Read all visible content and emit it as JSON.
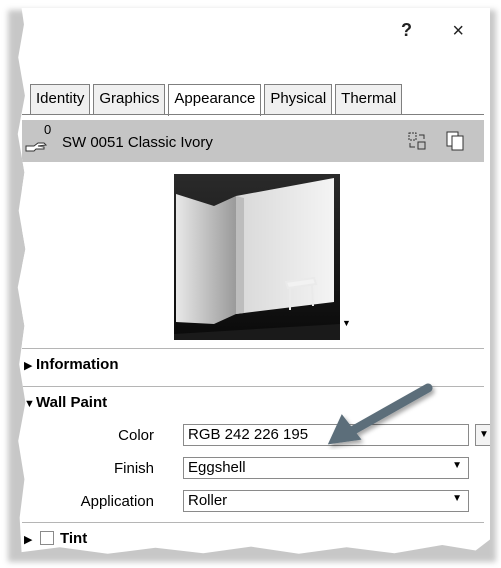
{
  "window": {
    "help_label": "?",
    "close_label": "×"
  },
  "tabs": [
    {
      "label": "Identity"
    },
    {
      "label": "Graphics"
    },
    {
      "label": "Appearance"
    },
    {
      "label": "Physical"
    },
    {
      "label": "Thermal"
    }
  ],
  "asset": {
    "count": "0",
    "name": "SW 0051 Classic Ivory"
  },
  "sections": {
    "information": "Information",
    "wall_paint": "Wall Paint",
    "tint": "Tint"
  },
  "properties": {
    "color_label": "Color",
    "color_value": "RGB 242 226 195",
    "finish_label": "Finish",
    "finish_value": "Eggshell",
    "application_label": "Application",
    "application_value": "Roller"
  },
  "colors": {
    "arrow": "#5b6e7a",
    "asset_bar": "#c5c5c5"
  }
}
